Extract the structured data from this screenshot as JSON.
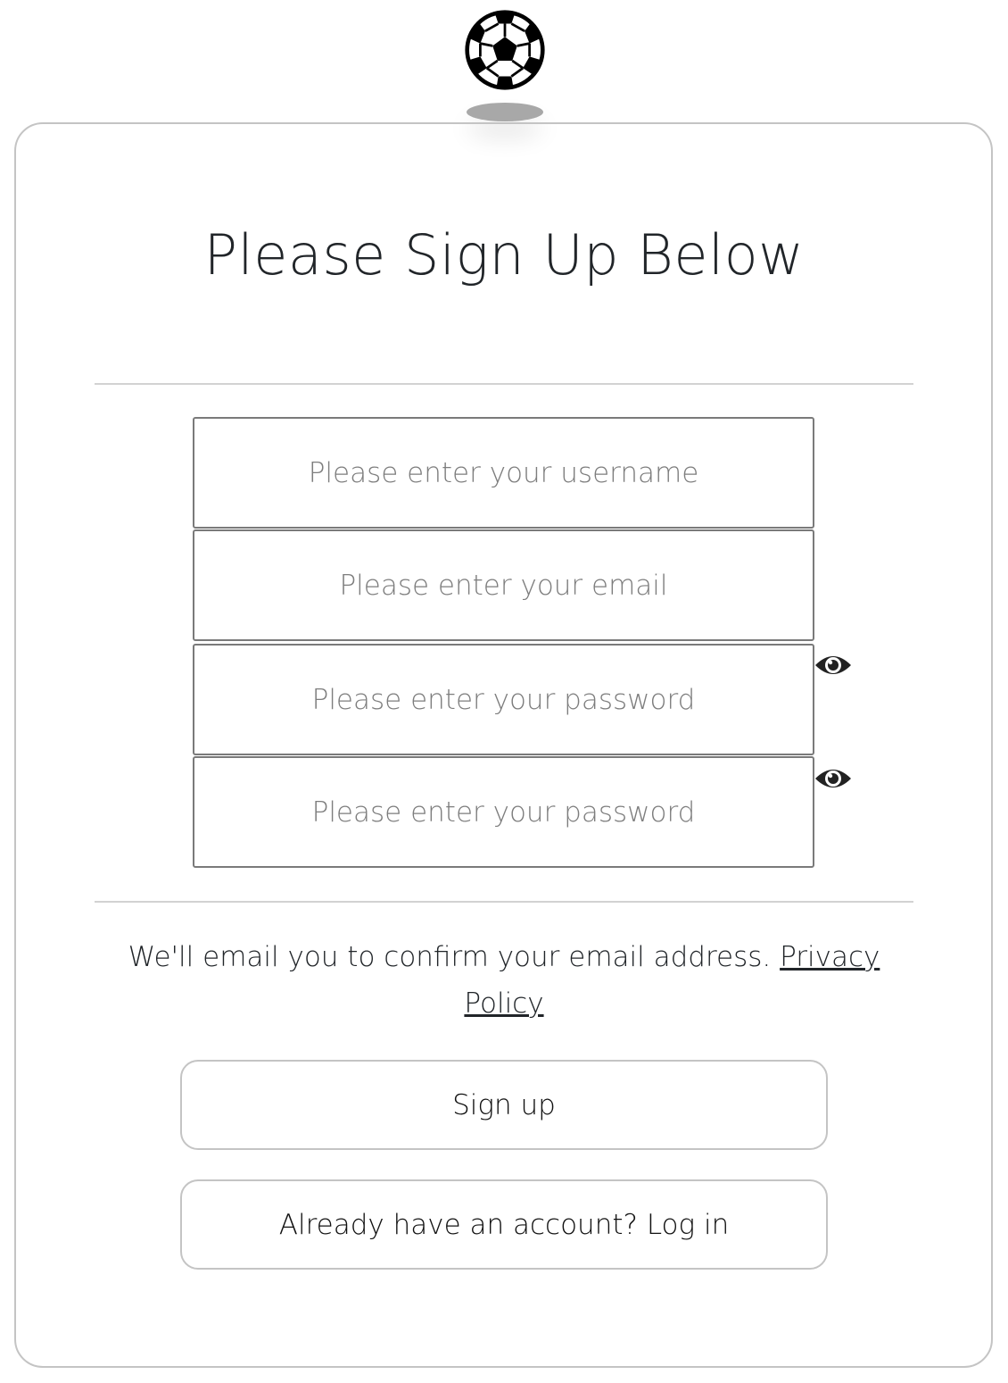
{
  "header": {
    "logo_icon": "soccer-ball-icon"
  },
  "page": {
    "title": "Please Sign Up Below"
  },
  "form": {
    "username": {
      "placeholder": "Please enter your username",
      "value": ""
    },
    "email": {
      "placeholder": "Please enter your email",
      "value": ""
    },
    "password": {
      "placeholder": "Please enter your password",
      "value": "",
      "toggle_icon": "eye-icon"
    },
    "password_confirm": {
      "placeholder": "Please enter your password",
      "value": "",
      "toggle_icon": "eye-icon"
    }
  },
  "notice": {
    "text": "We'll email you to confirm your email address. ",
    "privacy_link": "Privacy Policy"
  },
  "actions": {
    "signup_label": "Sign up",
    "login_label": "Already have an account? Log in"
  },
  "colors": {
    "border": "#c4c4c4",
    "input_border": "#7a7a7a",
    "text": "#212529",
    "placeholder": "#7d7d7d"
  }
}
